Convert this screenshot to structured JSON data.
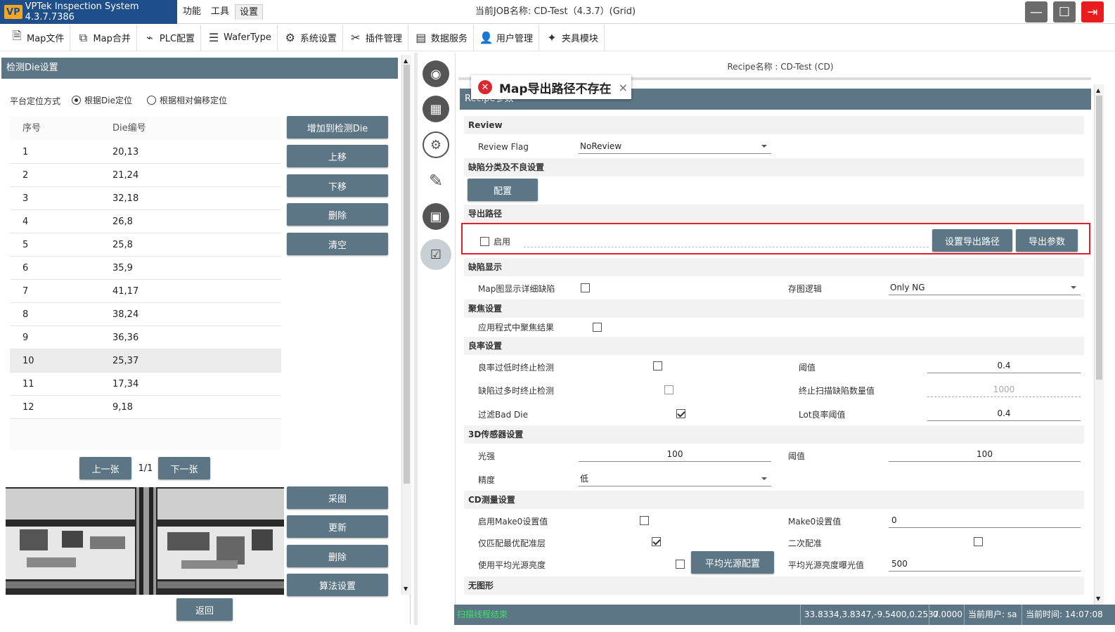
{
  "window": {
    "app_title": "VPTek Inspection System 4.3.7.7386",
    "logo_text": "VP",
    "menus": [
      "功能",
      "工具",
      "设置"
    ],
    "job_title": "当前JOB名称: CD-Test（4.3.7）(Grid)"
  },
  "toolbar": {
    "items": [
      {
        "label": "Map文件",
        "icon": "file-icon"
      },
      {
        "label": "Map合并",
        "icon": "merge-icon"
      },
      {
        "label": "PLC配置",
        "icon": "plc-icon"
      },
      {
        "label": "WaferType",
        "icon": "list-icon"
      },
      {
        "label": "系统设置",
        "icon": "gear-icon"
      },
      {
        "label": "插件管理",
        "icon": "tools-icon"
      },
      {
        "label": "数据服务",
        "icon": "data-icon"
      },
      {
        "label": "用户管理",
        "icon": "user-icon"
      },
      {
        "label": "夹具模块",
        "icon": "fixture-icon"
      }
    ]
  },
  "left": {
    "header": "检测Die设置",
    "position_label": "平台定位方式",
    "radio1": "根据Die定位",
    "radio2": "根据相对偏移定位",
    "col_index": "序号",
    "col_die": "Die编号",
    "rows": [
      {
        "index": "1",
        "die": "20,13"
      },
      {
        "index": "2",
        "die": "21,24"
      },
      {
        "index": "3",
        "die": "32,18"
      },
      {
        "index": "4",
        "die": "26,8"
      },
      {
        "index": "5",
        "die": "25,8"
      },
      {
        "index": "6",
        "die": "35,9"
      },
      {
        "index": "7",
        "die": "41,17"
      },
      {
        "index": "8",
        "die": "38,24"
      },
      {
        "index": "9",
        "die": "36,36"
      },
      {
        "index": "10",
        "die": "25,37"
      },
      {
        "index": "11",
        "die": "17,34"
      },
      {
        "index": "12",
        "die": "9,18"
      }
    ],
    "selected_row": "10",
    "btn_add": "增加到检测Die",
    "btn_up": "上移",
    "btn_down": "下移",
    "btn_delete": "删除",
    "btn_clear": "清空",
    "btn_prev": "上一张",
    "page": "1/1",
    "btn_next": "下一张",
    "btn_capture": "采图",
    "btn_update": "更新",
    "btn_delete2": "删除",
    "btn_algo": "算法设置",
    "btn_back": "返回"
  },
  "right": {
    "recipe_name": "Recipe名称 : CD-Test (CD)",
    "header": "Recipe参数",
    "toast": "Map导出路径不存在",
    "review": {
      "section": "Review",
      "flag_label": "Review Flag",
      "flag_value": "NoReview"
    },
    "defect_class": {
      "section": "缺陷分类及不良设置",
      "btn": "配置"
    },
    "export": {
      "section": "导出路径",
      "enable_label": "启用",
      "btn_set": "设置导出路径",
      "btn_params": "导出参数"
    },
    "defect_display": {
      "section": "缺陷显示",
      "map_detail_label": "Map图显示详细缺陷",
      "save_logic_label": "存图逻辑",
      "save_logic_value": "Only NG"
    },
    "focus": {
      "section": "聚焦设置",
      "apply_label": "应用程式中聚焦结果"
    },
    "yield": {
      "section": "良率设置",
      "low_stop_label": "良率过低时终止检测",
      "threshold_label": "阈值",
      "threshold_value": "0.4",
      "many_stop_label": "缺陷过多时终止检测",
      "stop_count_label": "终止扫描缺陷数量值",
      "stop_count_value": "1000",
      "bad_die_label": "过滤Bad Die",
      "lot_threshold_label": "Lot良率阈值",
      "lot_threshold_value": "0.4"
    },
    "sensor3d": {
      "section": "3D传感器设置",
      "light_label": "光强",
      "light_value": "100",
      "threshold_label": "阈值",
      "threshold_value": "100",
      "precision_label": "精度",
      "precision_value": "低"
    },
    "cd": {
      "section": "CD测量设置",
      "make0_enable_label": "启用Make0设置值",
      "make0_value_label": "Make0设置值",
      "make0_value": "0",
      "best_layer_label": "仅匹配最优配准层",
      "second_label": "二次配准",
      "avg_light_label": "使用平均光源亮度",
      "avg_light_btn": "平均光源配置",
      "avg_exposure_label": "平均光源亮度曝光值",
      "avg_exposure_value": "500"
    },
    "nopattern": {
      "section": "无图形"
    }
  },
  "status": {
    "message": "扫描线程结束",
    "coords": "33.8334,3.8347,-9.5400,0.2537",
    "value": "0.0000",
    "user": "当前用户: sa",
    "time": "当前时间: 14:07:08"
  }
}
